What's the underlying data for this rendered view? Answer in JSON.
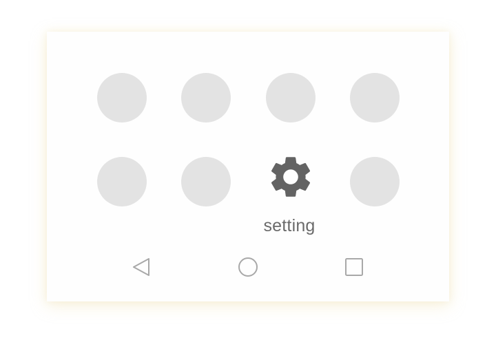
{
  "launcher": {
    "apps": [
      {
        "name": "app-placeholder-1"
      },
      {
        "name": "app-placeholder-2"
      },
      {
        "name": "app-placeholder-3"
      },
      {
        "name": "app-placeholder-4"
      },
      {
        "name": "app-placeholder-5"
      },
      {
        "name": "app-placeholder-6"
      },
      {
        "name": "settings",
        "label": "setting",
        "icon": "gear-icon"
      },
      {
        "name": "app-placeholder-8"
      }
    ],
    "placeholder_color": "#e3e3e3",
    "icon_color": "#636363"
  },
  "navbar": {
    "back_icon": "back-triangle-icon",
    "home_icon": "home-circle-icon",
    "recents_icon": "recents-square-icon",
    "icon_color": "#a8a8a8"
  }
}
